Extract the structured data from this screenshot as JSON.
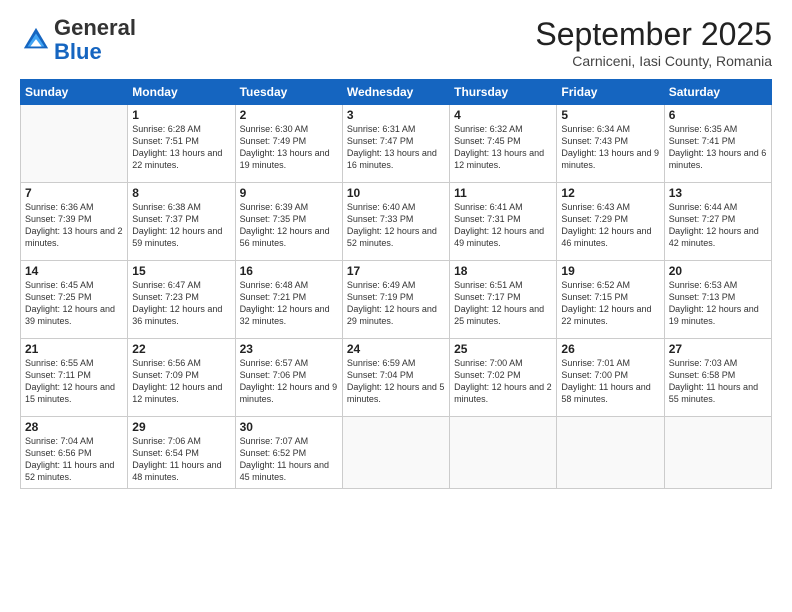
{
  "header": {
    "logo": {
      "line1": "General",
      "line2": "Blue"
    },
    "title": "September 2025",
    "location": "Carniceni, Iasi County, Romania"
  },
  "weekdays": [
    "Sunday",
    "Monday",
    "Tuesday",
    "Wednesday",
    "Thursday",
    "Friday",
    "Saturday"
  ],
  "weeks": [
    [
      {
        "day": "",
        "sunrise": "",
        "sunset": "",
        "daylight": ""
      },
      {
        "day": "1",
        "sunrise": "Sunrise: 6:28 AM",
        "sunset": "Sunset: 7:51 PM",
        "daylight": "Daylight: 13 hours and 22 minutes."
      },
      {
        "day": "2",
        "sunrise": "Sunrise: 6:30 AM",
        "sunset": "Sunset: 7:49 PM",
        "daylight": "Daylight: 13 hours and 19 minutes."
      },
      {
        "day": "3",
        "sunrise": "Sunrise: 6:31 AM",
        "sunset": "Sunset: 7:47 PM",
        "daylight": "Daylight: 13 hours and 16 minutes."
      },
      {
        "day": "4",
        "sunrise": "Sunrise: 6:32 AM",
        "sunset": "Sunset: 7:45 PM",
        "daylight": "Daylight: 13 hours and 12 minutes."
      },
      {
        "day": "5",
        "sunrise": "Sunrise: 6:34 AM",
        "sunset": "Sunset: 7:43 PM",
        "daylight": "Daylight: 13 hours and 9 minutes."
      },
      {
        "day": "6",
        "sunrise": "Sunrise: 6:35 AM",
        "sunset": "Sunset: 7:41 PM",
        "daylight": "Daylight: 13 hours and 6 minutes."
      }
    ],
    [
      {
        "day": "7",
        "sunrise": "Sunrise: 6:36 AM",
        "sunset": "Sunset: 7:39 PM",
        "daylight": "Daylight: 13 hours and 2 minutes."
      },
      {
        "day": "8",
        "sunrise": "Sunrise: 6:38 AM",
        "sunset": "Sunset: 7:37 PM",
        "daylight": "Daylight: 12 hours and 59 minutes."
      },
      {
        "day": "9",
        "sunrise": "Sunrise: 6:39 AM",
        "sunset": "Sunset: 7:35 PM",
        "daylight": "Daylight: 12 hours and 56 minutes."
      },
      {
        "day": "10",
        "sunrise": "Sunrise: 6:40 AM",
        "sunset": "Sunset: 7:33 PM",
        "daylight": "Daylight: 12 hours and 52 minutes."
      },
      {
        "day": "11",
        "sunrise": "Sunrise: 6:41 AM",
        "sunset": "Sunset: 7:31 PM",
        "daylight": "Daylight: 12 hours and 49 minutes."
      },
      {
        "day": "12",
        "sunrise": "Sunrise: 6:43 AM",
        "sunset": "Sunset: 7:29 PM",
        "daylight": "Daylight: 12 hours and 46 minutes."
      },
      {
        "day": "13",
        "sunrise": "Sunrise: 6:44 AM",
        "sunset": "Sunset: 7:27 PM",
        "daylight": "Daylight: 12 hours and 42 minutes."
      }
    ],
    [
      {
        "day": "14",
        "sunrise": "Sunrise: 6:45 AM",
        "sunset": "Sunset: 7:25 PM",
        "daylight": "Daylight: 12 hours and 39 minutes."
      },
      {
        "day": "15",
        "sunrise": "Sunrise: 6:47 AM",
        "sunset": "Sunset: 7:23 PM",
        "daylight": "Daylight: 12 hours and 36 minutes."
      },
      {
        "day": "16",
        "sunrise": "Sunrise: 6:48 AM",
        "sunset": "Sunset: 7:21 PM",
        "daylight": "Daylight: 12 hours and 32 minutes."
      },
      {
        "day": "17",
        "sunrise": "Sunrise: 6:49 AM",
        "sunset": "Sunset: 7:19 PM",
        "daylight": "Daylight: 12 hours and 29 minutes."
      },
      {
        "day": "18",
        "sunrise": "Sunrise: 6:51 AM",
        "sunset": "Sunset: 7:17 PM",
        "daylight": "Daylight: 12 hours and 25 minutes."
      },
      {
        "day": "19",
        "sunrise": "Sunrise: 6:52 AM",
        "sunset": "Sunset: 7:15 PM",
        "daylight": "Daylight: 12 hours and 22 minutes."
      },
      {
        "day": "20",
        "sunrise": "Sunrise: 6:53 AM",
        "sunset": "Sunset: 7:13 PM",
        "daylight": "Daylight: 12 hours and 19 minutes."
      }
    ],
    [
      {
        "day": "21",
        "sunrise": "Sunrise: 6:55 AM",
        "sunset": "Sunset: 7:11 PM",
        "daylight": "Daylight: 12 hours and 15 minutes."
      },
      {
        "day": "22",
        "sunrise": "Sunrise: 6:56 AM",
        "sunset": "Sunset: 7:09 PM",
        "daylight": "Daylight: 12 hours and 12 minutes."
      },
      {
        "day": "23",
        "sunrise": "Sunrise: 6:57 AM",
        "sunset": "Sunset: 7:06 PM",
        "daylight": "Daylight: 12 hours and 9 minutes."
      },
      {
        "day": "24",
        "sunrise": "Sunrise: 6:59 AM",
        "sunset": "Sunset: 7:04 PM",
        "daylight": "Daylight: 12 hours and 5 minutes."
      },
      {
        "day": "25",
        "sunrise": "Sunrise: 7:00 AM",
        "sunset": "Sunset: 7:02 PM",
        "daylight": "Daylight: 12 hours and 2 minutes."
      },
      {
        "day": "26",
        "sunrise": "Sunrise: 7:01 AM",
        "sunset": "Sunset: 7:00 PM",
        "daylight": "Daylight: 11 hours and 58 minutes."
      },
      {
        "day": "27",
        "sunrise": "Sunrise: 7:03 AM",
        "sunset": "Sunset: 6:58 PM",
        "daylight": "Daylight: 11 hours and 55 minutes."
      }
    ],
    [
      {
        "day": "28",
        "sunrise": "Sunrise: 7:04 AM",
        "sunset": "Sunset: 6:56 PM",
        "daylight": "Daylight: 11 hours and 52 minutes."
      },
      {
        "day": "29",
        "sunrise": "Sunrise: 7:06 AM",
        "sunset": "Sunset: 6:54 PM",
        "daylight": "Daylight: 11 hours and 48 minutes."
      },
      {
        "day": "30",
        "sunrise": "Sunrise: 7:07 AM",
        "sunset": "Sunset: 6:52 PM",
        "daylight": "Daylight: 11 hours and 45 minutes."
      },
      {
        "day": "",
        "sunrise": "",
        "sunset": "",
        "daylight": ""
      },
      {
        "day": "",
        "sunrise": "",
        "sunset": "",
        "daylight": ""
      },
      {
        "day": "",
        "sunrise": "",
        "sunset": "",
        "daylight": ""
      },
      {
        "day": "",
        "sunrise": "",
        "sunset": "",
        "daylight": ""
      }
    ]
  ]
}
